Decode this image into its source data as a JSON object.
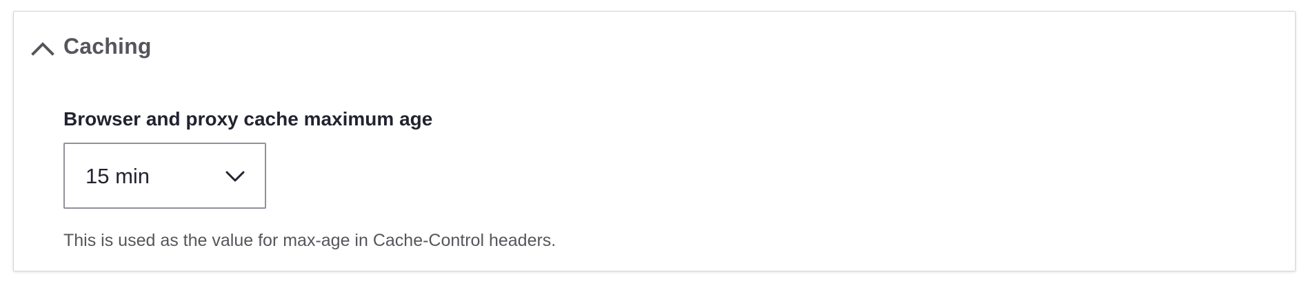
{
  "section": {
    "title": "Caching",
    "expanded": true,
    "toggle_icon": "chevron-up-icon"
  },
  "field": {
    "label": "Browser and proxy cache maximum age",
    "selected_value": "15 min",
    "dropdown_icon": "chevron-down-icon",
    "description": "This is used as the value for max-age in Cache-Control headers."
  },
  "colors": {
    "title_text": "#55565b",
    "label_text": "#222330",
    "border": "#8e929c",
    "panel_border": "#d4d4d8"
  }
}
